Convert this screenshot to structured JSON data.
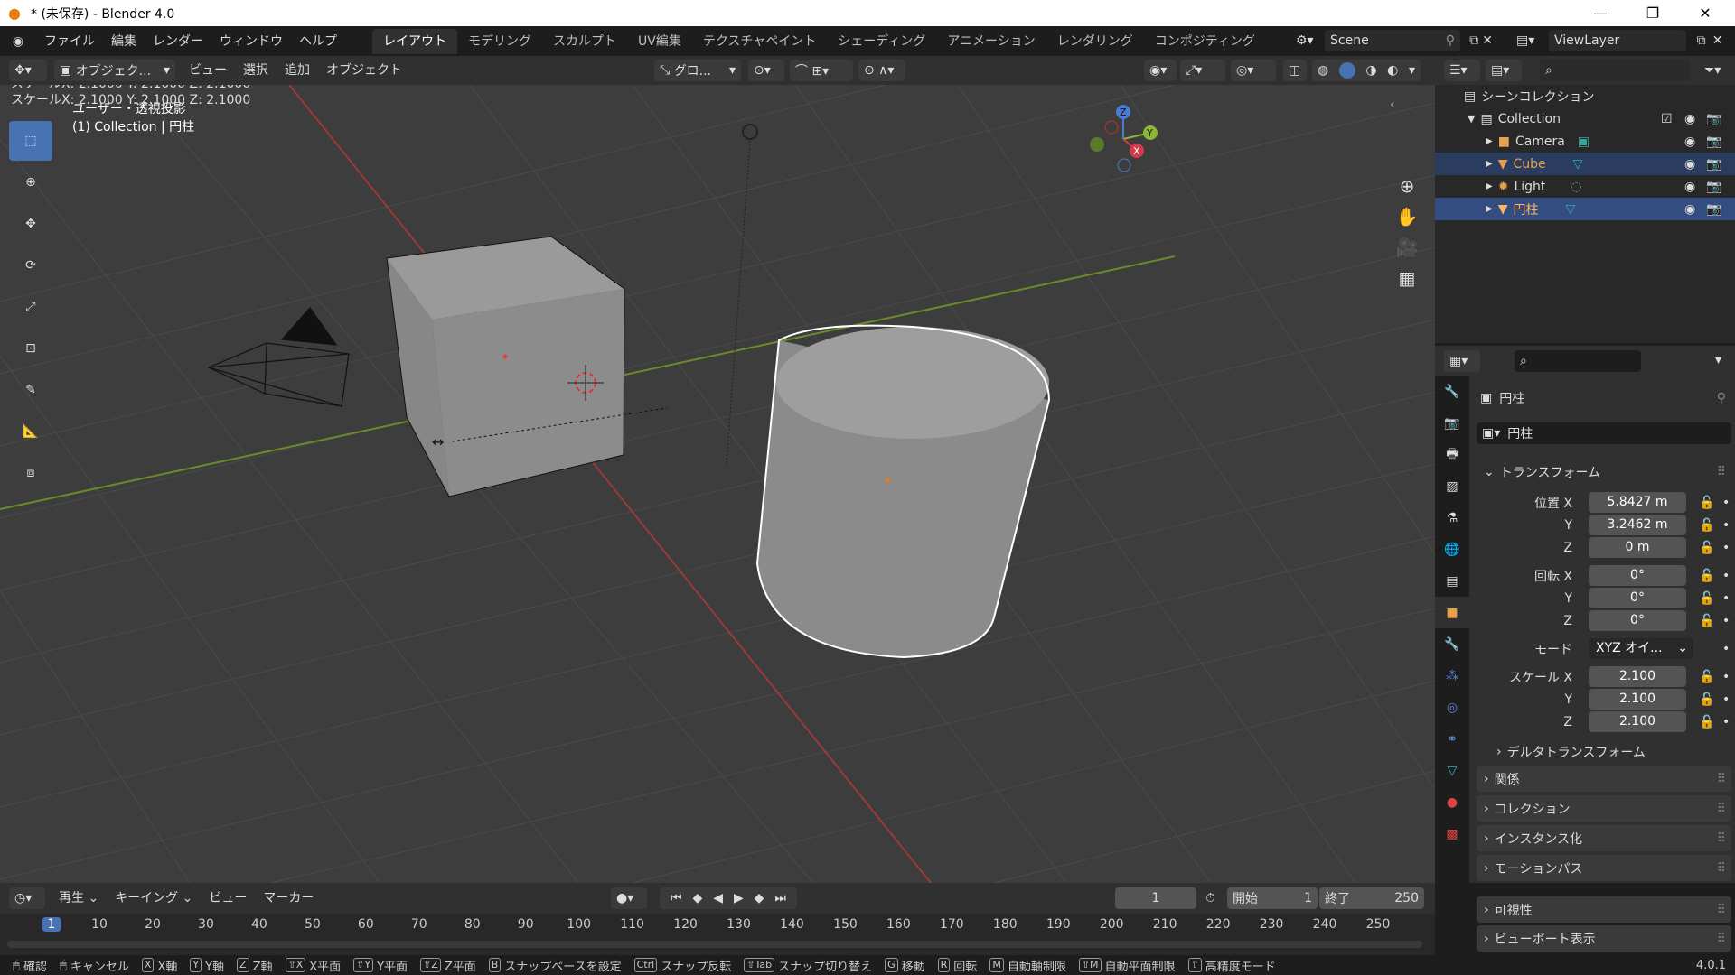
{
  "window": {
    "title": "* (未保存) - Blender 4.0"
  },
  "topbar": {
    "menus": [
      "ファイル",
      "編集",
      "レンダー",
      "ウィンドウ",
      "ヘルプ"
    ],
    "workspaces": [
      "レイアウト",
      "モデリング",
      "スカルプト",
      "UV編集",
      "テクスチャペイント",
      "シェーディング",
      "アニメーション",
      "レンダリング",
      "コンポジティング"
    ],
    "scene": "Scene",
    "view_layer": "ViewLayer"
  },
  "viewport_header": {
    "mode": "オブジェク...",
    "menus": [
      "ビュー",
      "選択",
      "追加",
      "オブジェクト"
    ],
    "orientation": "グロ..."
  },
  "viewport": {
    "operator_status": "スケールX: 2.1000   Y: 2.1000   Z: 2.1000",
    "view_name": "ユーザー・透視投影",
    "collection_info": "(1) Collection | 円柱",
    "gizmo": {
      "x": "X",
      "y": "Y",
      "z": "Z"
    }
  },
  "outliner": {
    "root": "シーンコレクション",
    "collection": "Collection",
    "items": [
      {
        "name": "Camera",
        "color": "#dcdcdc",
        "icon": "camera-icon"
      },
      {
        "name": "Cube",
        "color": "#e8a24e",
        "icon": "mesh-icon"
      },
      {
        "name": "Light",
        "color": "#dcdcdc",
        "icon": "light-icon"
      },
      {
        "name": "円柱",
        "color": "#ffb65c",
        "icon": "mesh-icon"
      }
    ]
  },
  "properties": {
    "object_name": "円柱",
    "object_field": "円柱",
    "transform_header": "トランスフォーム",
    "location": {
      "label": "位置",
      "x": "5.8427 m",
      "y": "3.2462 m",
      "z": "0 m"
    },
    "rotation": {
      "label": "回転",
      "x": "0°",
      "y": "0°",
      "z": "0°"
    },
    "mode": {
      "label": "モード",
      "value": "XYZ オイ..."
    },
    "scale": {
      "label": "スケール",
      "x": "2.100",
      "y": "2.100",
      "z": "2.100"
    },
    "axis": {
      "x": "X",
      "y": "Y",
      "z": "Z"
    },
    "delta": "デルタトランスフォーム",
    "panels": [
      "関係",
      "コレクション",
      "インスタンス化",
      "モーションパス",
      "可視性",
      "ビューポート表示"
    ]
  },
  "timeline": {
    "menus": [
      "再生",
      "キーイング",
      "ビュー",
      "マーカー"
    ],
    "current_frame": "1",
    "start_label": "開始",
    "start": "1",
    "end_label": "終了",
    "end": "250",
    "ticks": [
      "1",
      "10",
      "20",
      "30",
      "40",
      "50",
      "60",
      "70",
      "80",
      "90",
      "100",
      "110",
      "120",
      "130",
      "140",
      "150",
      "160",
      "170",
      "180",
      "190",
      "200",
      "210",
      "220",
      "230",
      "240",
      "250"
    ]
  },
  "statusbar": {
    "confirm": "確認",
    "cancel": "キャンセル",
    "items": [
      {
        "key": "X",
        "label": "X軸"
      },
      {
        "key": "Y",
        "label": "Y軸"
      },
      {
        "key": "Z",
        "label": "Z軸"
      },
      {
        "key": "⇧X",
        "label": "X平面"
      },
      {
        "key": "⇧Y",
        "label": "Y平面"
      },
      {
        "key": "⇧Z",
        "label": "Z平面"
      },
      {
        "key": "B",
        "label": "スナップベースを設定"
      },
      {
        "key": "Ctrl",
        "label": "スナップ反転"
      },
      {
        "key": "⇧Tab",
        "label": "スナップ切り替え"
      },
      {
        "key": "G",
        "label": "移動"
      },
      {
        "key": "R",
        "label": "回転"
      },
      {
        "key": "M",
        "label": "自動軸制限"
      },
      {
        "key": "⇧M",
        "label": "自動平面制限"
      },
      {
        "key": "⇧",
        "label": "高精度モード"
      }
    ],
    "version": "4.0.1"
  }
}
